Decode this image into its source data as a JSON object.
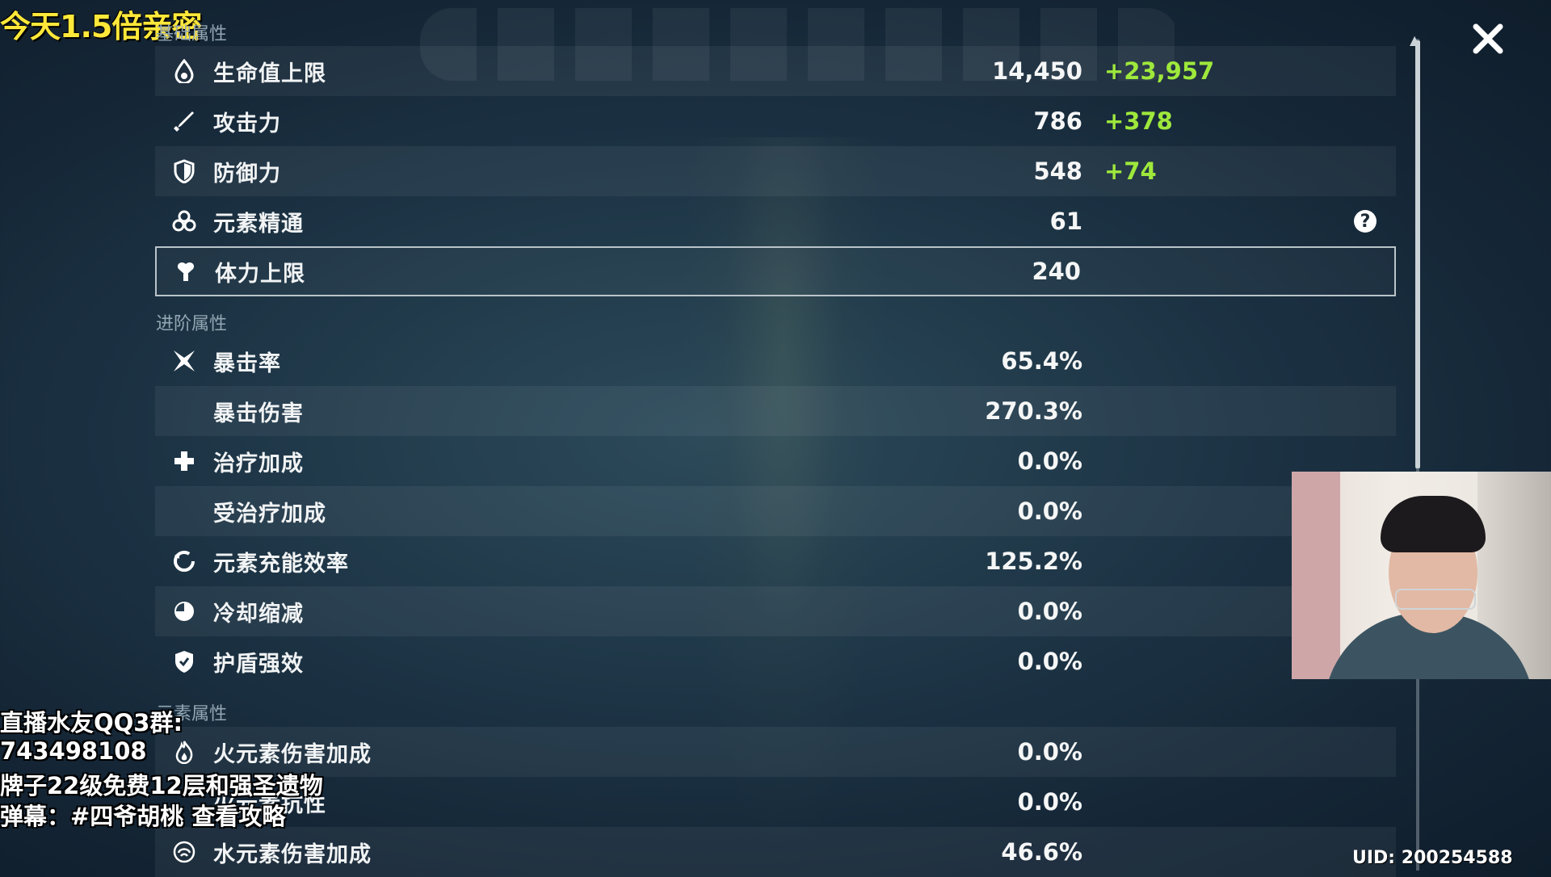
{
  "stream_title": "今天1.5倍亲密",
  "sections": {
    "base": "基础属性",
    "advanced": "进阶属性",
    "elemental": "元素属性"
  },
  "base_stats": [
    {
      "icon": "hp-drop-icon",
      "label": "生命值上限",
      "value": "14,450",
      "bonus": "+23,957"
    },
    {
      "icon": "sword-icon",
      "label": "攻击力",
      "value": "786",
      "bonus": "+378"
    },
    {
      "icon": "shield-icon",
      "label": "防御力",
      "value": "548",
      "bonus": "+74"
    },
    {
      "icon": "elemental-mastery-icon",
      "label": "元素精通",
      "value": "61",
      "bonus": ""
    },
    {
      "icon": "stamina-icon",
      "label": "体力上限",
      "value": "240",
      "bonus": ""
    }
  ],
  "advanced_stats": [
    {
      "icon": "crit-rate-icon",
      "label": "暴击率",
      "value": "65.4%"
    },
    {
      "icon": "",
      "label": "暴击伤害",
      "value": "270.3%"
    },
    {
      "icon": "healing-cross-icon",
      "label": "治疗加成",
      "value": "0.0%"
    },
    {
      "icon": "",
      "label": "受治疗加成",
      "value": "0.0%"
    },
    {
      "icon": "energy-recharge-icon",
      "label": "元素充能效率",
      "value": "125.2%"
    },
    {
      "icon": "cooldown-icon",
      "label": "冷却缩减",
      "value": "0.0%"
    },
    {
      "icon": "shield-strength-icon",
      "label": "护盾强效",
      "value": "0.0%"
    }
  ],
  "elemental_stats": [
    {
      "icon": "pyro-icon",
      "label": "火元素伤害加成",
      "value": "0.0%"
    },
    {
      "icon": "",
      "label": "火元素抗性",
      "value": "0.0%"
    },
    {
      "icon": "hydro-icon",
      "label": "水元素伤害加成",
      "value": "46.6%"
    }
  ],
  "help_label": "?",
  "overlay": {
    "line1": "直播水友QQ3群:",
    "line2": "743498108",
    "line3": "牌子22级免费12层和强圣遗物",
    "line4": "弹幕：#四爷胡桃 查看攻略"
  },
  "uid": "UID: 200254588",
  "colors": {
    "bonus_green": "#9ee83c",
    "title_yellow": "#ffe83a",
    "section_gray": "#93a6b3"
  }
}
